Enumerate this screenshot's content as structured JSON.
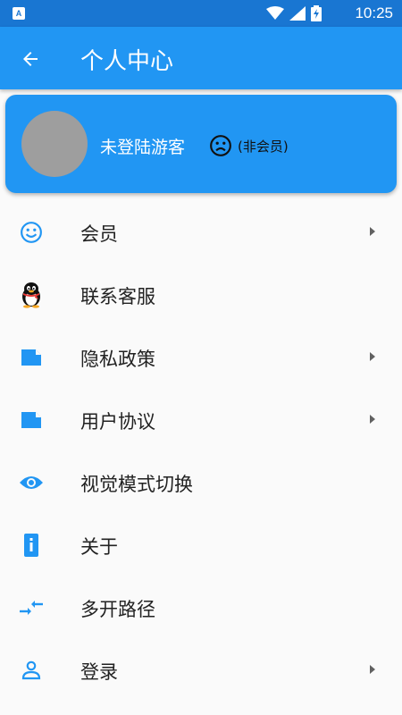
{
  "status_bar": {
    "time": "10:25",
    "badge": "A"
  },
  "app_bar": {
    "title": "个人中心"
  },
  "profile": {
    "name": "未登陆游客",
    "member_status": "(非会员)"
  },
  "menu": {
    "items": [
      {
        "label": "会员",
        "icon": "smiley-icon",
        "has_arrow": true
      },
      {
        "label": "联系客服",
        "icon": "qq-penguin-icon",
        "has_arrow": false
      },
      {
        "label": "隐私政策",
        "icon": "folded-note-icon",
        "has_arrow": true
      },
      {
        "label": "用户协议",
        "icon": "folded-note-icon",
        "has_arrow": true
      },
      {
        "label": "视觉模式切换",
        "icon": "eye-icon",
        "has_arrow": false
      },
      {
        "label": "关于",
        "icon": "info-icon",
        "has_arrow": false
      },
      {
        "label": "多开路径",
        "icon": "compare-arrows-icon",
        "has_arrow": false
      },
      {
        "label": "登录",
        "icon": "person-icon",
        "has_arrow": true
      }
    ]
  },
  "colors": {
    "primary": "#2196f3",
    "status_bar": "#1976d2",
    "background": "#fafafa",
    "arrow": "#616161"
  }
}
